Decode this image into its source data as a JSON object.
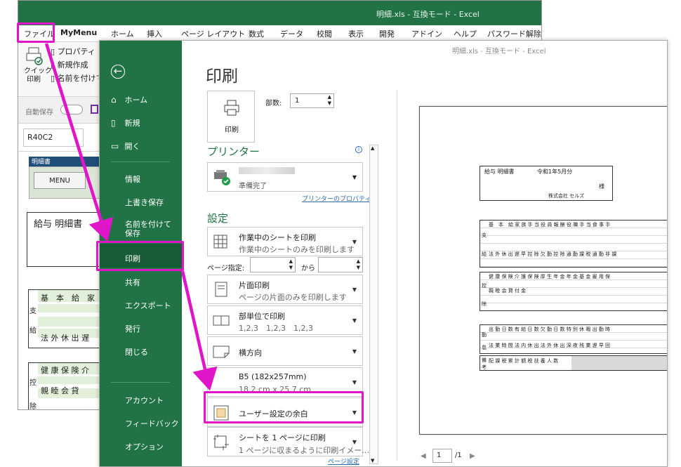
{
  "bg": {
    "title": "明細.xls - 互換モード - Excel",
    "tabs": [
      "ファイル",
      "MyMenu",
      "ホーム",
      "挿入",
      "ページ レイアウト",
      "数式",
      "データ",
      "校閲",
      "表示",
      "開発",
      "アドイン",
      "ヘルプ",
      "パスワード解除"
    ],
    "ribbon": {
      "quick_print": "クイック\n印刷",
      "property": "プロパティ",
      "new": "新規作成",
      "save_as": "名前を付けて"
    },
    "autosave": "自動保存",
    "namebox": "R40C2",
    "sheet": {
      "tab_label": "明細書",
      "menu_button": "MENU",
      "title": "給与 明細書",
      "side_shi": "支",
      "side_kyu": "給",
      "side_kou": "控",
      "side_jo": "除",
      "row1": "基　本　給　家",
      "row2": "法 外 休 出 遅",
      "row3": "健 康 保 険 介",
      "row4": "親 睦 会 貸"
    }
  },
  "backstage": {
    "small_title": "明細.xls - 互換モード - Excel",
    "nav": {
      "back": "←",
      "home": "ホーム",
      "new": "新規",
      "open": "開く",
      "info": "情報",
      "overwrite": "上書き保存",
      "save_as": "名前を付けて保存",
      "print": "印刷",
      "share": "共有",
      "export": "エクスポート",
      "publish": "発行",
      "close": "閉じる",
      "account": "アカウント",
      "feedback": "フィードバック",
      "options": "オプション"
    },
    "heading": "印刷",
    "print_button": "印刷",
    "copies_label": "部数:",
    "copies_value": "1",
    "printer_heading": "プリンター",
    "printer_status": "準備完了",
    "printer_properties": "プリンターのプロパティ",
    "settings_heading": "設定",
    "settings": [
      {
        "main": "作業中のシートを印刷",
        "sub": "作業中のシートのみを印刷します"
      },
      {
        "main": "片面印刷",
        "sub": "ページの片面のみを印刷します"
      },
      {
        "main": "部単位で印刷",
        "sub": "1,2,3　1,2,3　1,2,3"
      },
      {
        "main": "横方向",
        "sub": ""
      },
      {
        "main": "B5 (182x257mm)",
        "sub": "18.2 cm x 25.7 cm"
      },
      {
        "main": "ユーザー設定の余白",
        "sub": ""
      },
      {
        "main": "シートを 1 ページに印刷",
        "sub": "1 ページに収まるように印刷イメー…"
      }
    ],
    "pages_label": "ページ指定:",
    "pages_to": "から",
    "page_setup": "ページ設定",
    "pager_current": "1",
    "pager_total": "/1"
  },
  "preview": {
    "title": "給与 明細書",
    "date": "令和1年5月分",
    "sama": "様",
    "company": "株式会社 セルズ",
    "row_a": "基　本　給 家 族 手 当 役 員 報 酬 役 職 手 当 食 事 手",
    "row_b": "法 外 休 出 遅 早 控 除 欠 勤 控 除 通 勤 課 税 通 勤 非 課",
    "row_c": "健 康 保 険 介 護 保 険 厚 生 年 金 年 金 基 金 雇 用 保",
    "row_d": "親 睦 会 貸 付 金",
    "row_e": "出 勤 日 数 有 給 日 数 欠 勤 日 数 特 別 休 暇 出 勤 時",
    "row_f": "法 業 時 間 法 内 休 出 法 外 休 出 深 夜 残 業 遅 早 回",
    "row_g": "配 課 税 累 計 額 税 扶 養 人 数",
    "side_shi": "支",
    "side_kyu": "給",
    "side_kou": "控",
    "side_jo": "除",
    "side_kin": "勤",
    "side_mu": "怠",
    "side_bi": "備",
    "side_kou2": "考"
  },
  "colors": {
    "excel_green": "#217346",
    "nav_active": "#185c37",
    "highlight": "#e014c8",
    "sheet_green": "#e2efda"
  }
}
